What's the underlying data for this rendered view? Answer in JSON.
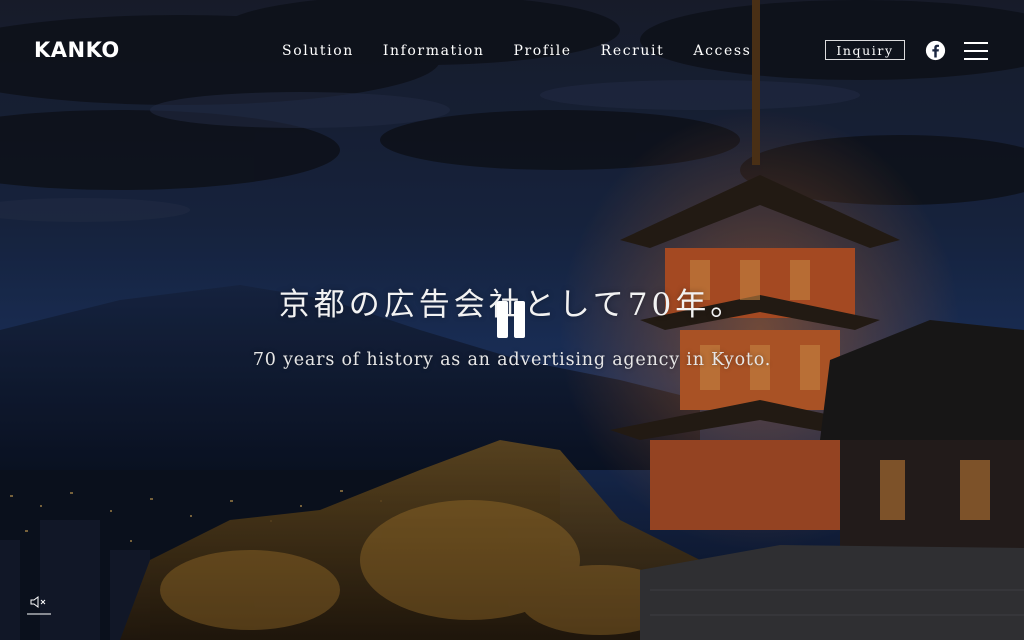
{
  "header": {
    "logo": "KANKO",
    "nav": [
      {
        "label": "Solution"
      },
      {
        "label": "Information"
      },
      {
        "label": "Profile"
      },
      {
        "label": "Recruit"
      },
      {
        "label": "Access"
      }
    ],
    "inquiry_label": "Inquiry",
    "social_icon": "facebook-icon",
    "menu_icon": "hamburger-menu-icon"
  },
  "hero": {
    "headline": "京都の広告会社として70年。",
    "subline": "70 years of history as an advertising agency in Kyoto.",
    "video_state": "playing",
    "pause_icon": "pause-icon",
    "audio_icon": "mute-icon"
  },
  "colors": {
    "text": "#ffffff",
    "sky_top": "#1c2740",
    "sky_mid": "#1f3463",
    "pagoda": "#c8582a",
    "lights": "#e8a640"
  }
}
